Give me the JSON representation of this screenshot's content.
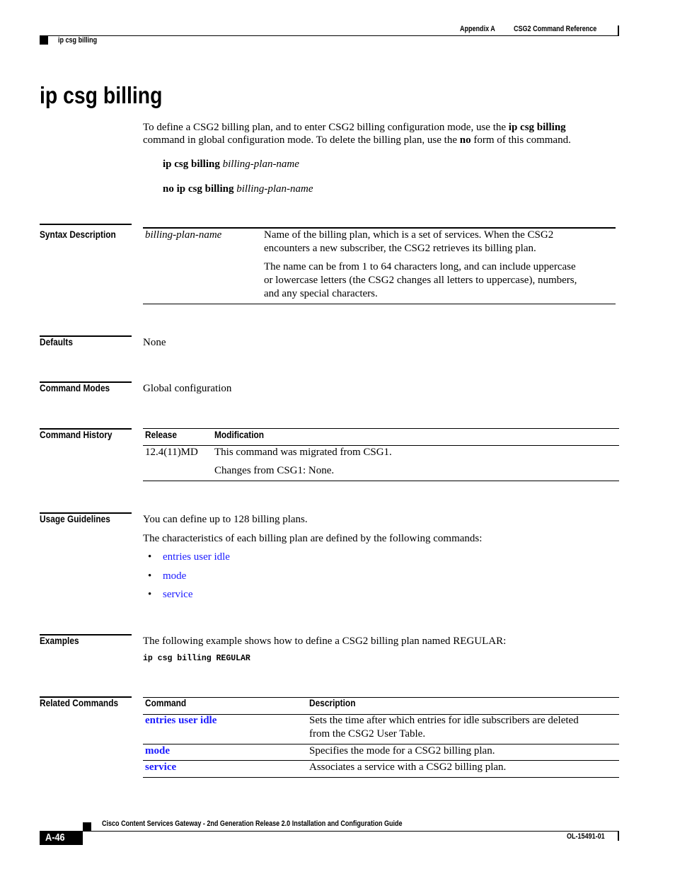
{
  "header": {
    "appendix": "Appendix A",
    "chapter": "CSG2 Command Reference",
    "running_title": "ip csg billing"
  },
  "title": "ip csg billing",
  "intro": {
    "p1_a": "To define a CSG2 billing plan, and to enter CSG2 billing configuration mode, use the ",
    "p1_b": "ip csg billing",
    "p2_a": "command in global configuration mode. To delete the billing plan, use the ",
    "p2_b": "no",
    "p2_c": " form of this command."
  },
  "syntax": [
    {
      "cmd": "ip csg billing",
      "arg": "billing-plan-name"
    },
    {
      "cmd": "no ip csg billing",
      "arg": "billing-plan-name"
    }
  ],
  "syntax_description": {
    "label": "Syntax Description",
    "param": "billing-plan-name",
    "lines": [
      "Name of the billing plan, which is a set of services. When the CSG2",
      "encounters a new subscriber, the CSG2 retrieves its billing plan.",
      "The name can be from 1 to 64 characters long, and can include uppercase",
      "or lowercase letters (the CSG2 changes all letters to uppercase), numbers,",
      "and any special characters."
    ]
  },
  "defaults": {
    "label": "Defaults",
    "value": "None"
  },
  "command_modes": {
    "label": "Command Modes",
    "value": "Global configuration"
  },
  "command_history": {
    "label": "Command History",
    "headers": [
      "Release",
      "Modification"
    ],
    "rows": [
      {
        "release": "12.4(11)MD",
        "mods": [
          "This command was migrated from CSG1.",
          "Changes from CSG1: None."
        ]
      }
    ]
  },
  "usage_guidelines": {
    "label": "Usage Guidelines",
    "p1": "You can define up to 128 billing plans.",
    "p2": "The characteristics of each billing plan are defined by the following commands:",
    "bullets": [
      "entries user idle",
      "mode",
      "service"
    ]
  },
  "examples": {
    "label": "Examples",
    "text": "The following example shows how to define a CSG2 billing plan named REGULAR:",
    "code": "ip csg billing REGULAR"
  },
  "related_commands": {
    "label": "Related Commands",
    "headers": [
      "Command",
      "Description"
    ],
    "rows": [
      {
        "cmd": "entries user idle",
        "desc": [
          "Sets the time after which entries for idle subscribers are deleted",
          "from the CSG2 User Table."
        ]
      },
      {
        "cmd": "mode",
        "desc": [
          "Specifies the mode for a CSG2 billing plan."
        ]
      },
      {
        "cmd": "service",
        "desc": [
          "Associates a service with a CSG2 billing plan."
        ]
      }
    ]
  },
  "footer": {
    "guide_title": "Cisco Content Services Gateway - 2nd Generation Release 2.0 Installation and Configuration Guide",
    "page_number": "A-46",
    "doc_number": "OL-15491-01"
  },
  "colors": {
    "link": "#1a1aff"
  }
}
